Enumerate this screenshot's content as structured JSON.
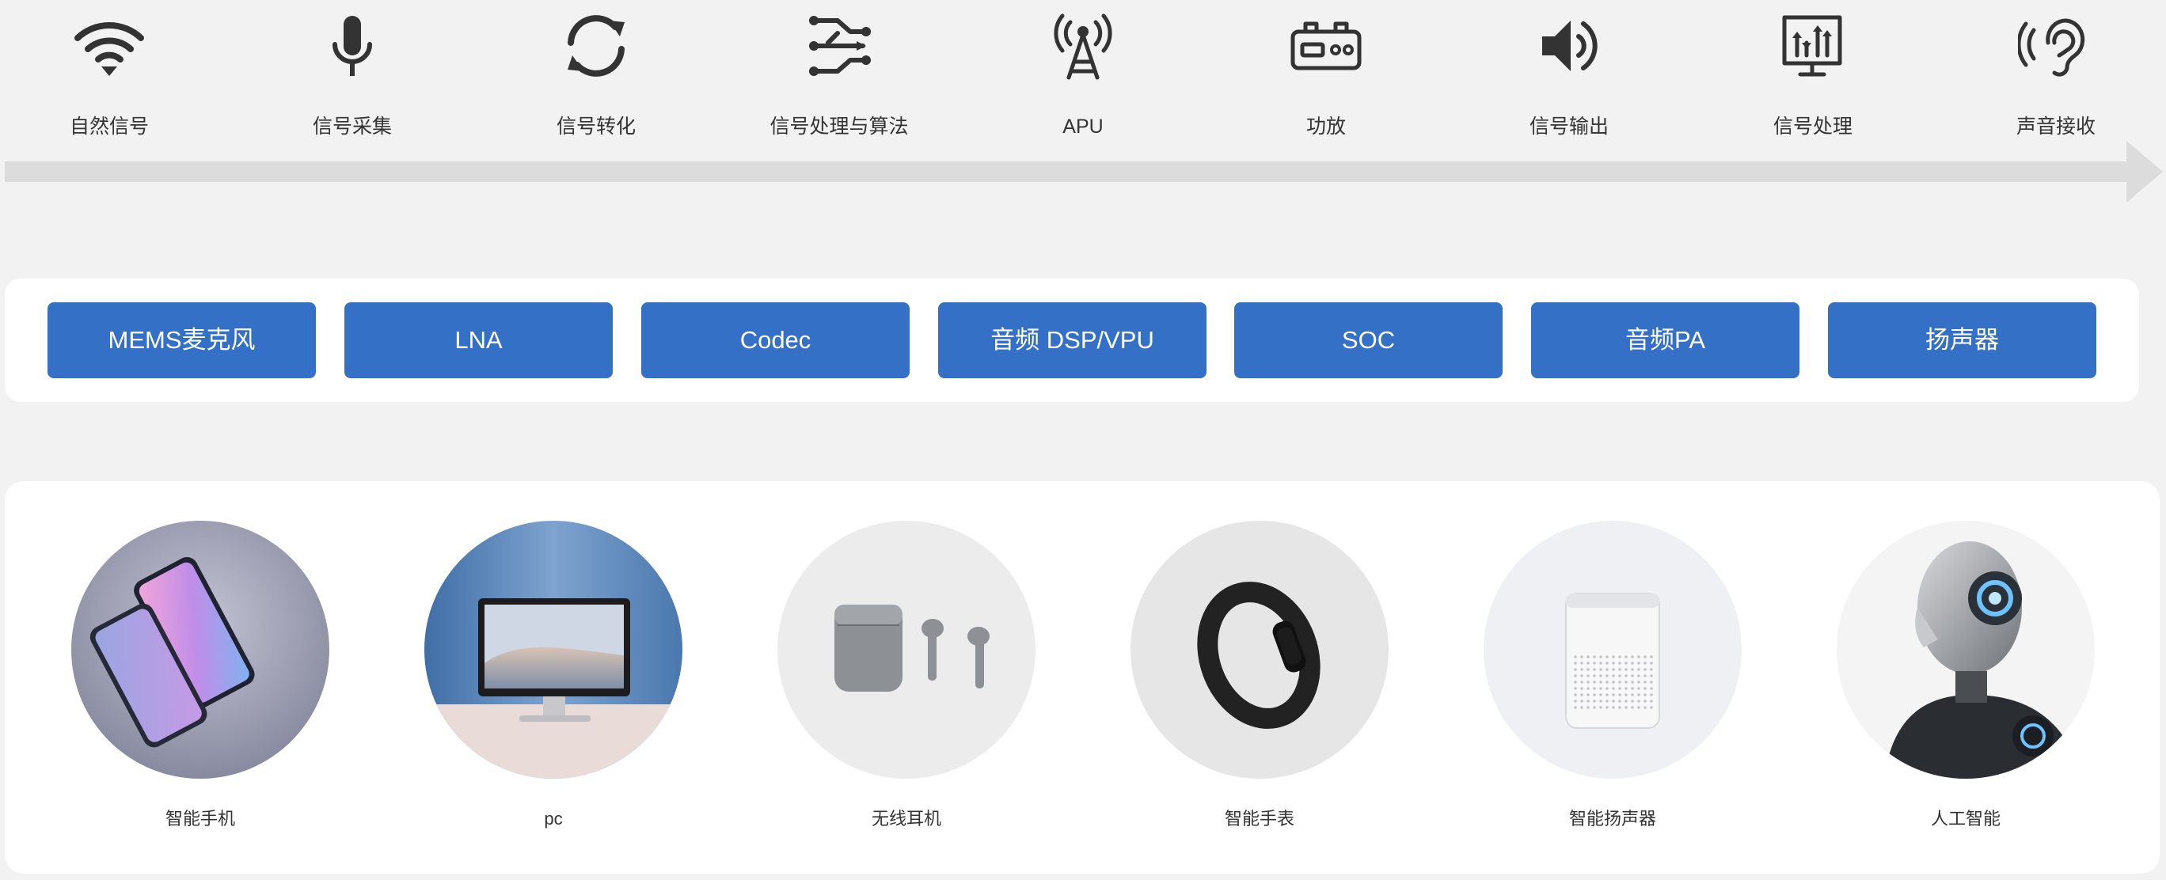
{
  "stages": [
    {
      "label": "自然信号",
      "icon": "wifi-signal-icon"
    },
    {
      "label": "信号采集",
      "icon": "microphone-icon"
    },
    {
      "label": "信号转化",
      "icon": "refresh-cycle-icon"
    },
    {
      "label": "信号处理与算法",
      "icon": "circuit-branch-icon"
    },
    {
      "label": "APU",
      "icon": "radio-tower-icon"
    },
    {
      "label": "功放",
      "icon": "amplifier-icon"
    },
    {
      "label": "信号输出",
      "icon": "speaker-volume-icon"
    },
    {
      "label": "信号处理",
      "icon": "equalizer-monitor-icon"
    },
    {
      "label": "声音接收",
      "icon": "ear-hearing-icon"
    }
  ],
  "components": [
    {
      "label": "MEMS麦克风"
    },
    {
      "label": "LNA"
    },
    {
      "label": "Codec"
    },
    {
      "label": "音频 DSP/VPU"
    },
    {
      "label": "SOC"
    },
    {
      "label": "音频PA"
    },
    {
      "label": "扬声器"
    }
  ],
  "applications": [
    {
      "label": "智能手机",
      "image": "smartphones-photo"
    },
    {
      "label": "pc",
      "image": "desktop-monitor-photo"
    },
    {
      "label": "无线耳机",
      "image": "wireless-earbuds-photo"
    },
    {
      "label": "智能手表",
      "image": "smart-band-photo"
    },
    {
      "label": "智能扬声器",
      "image": "smart-speaker-photo"
    },
    {
      "label": "人工智能",
      "image": "humanoid-robot-photo"
    }
  ],
  "colors": {
    "page_background": "#f2f2f2",
    "panel_background": "#ffffff",
    "component_chip": "#3370c6",
    "component_text": "#ffffff",
    "icon": "#333333",
    "flow_arrow": "#dcdcdc"
  }
}
